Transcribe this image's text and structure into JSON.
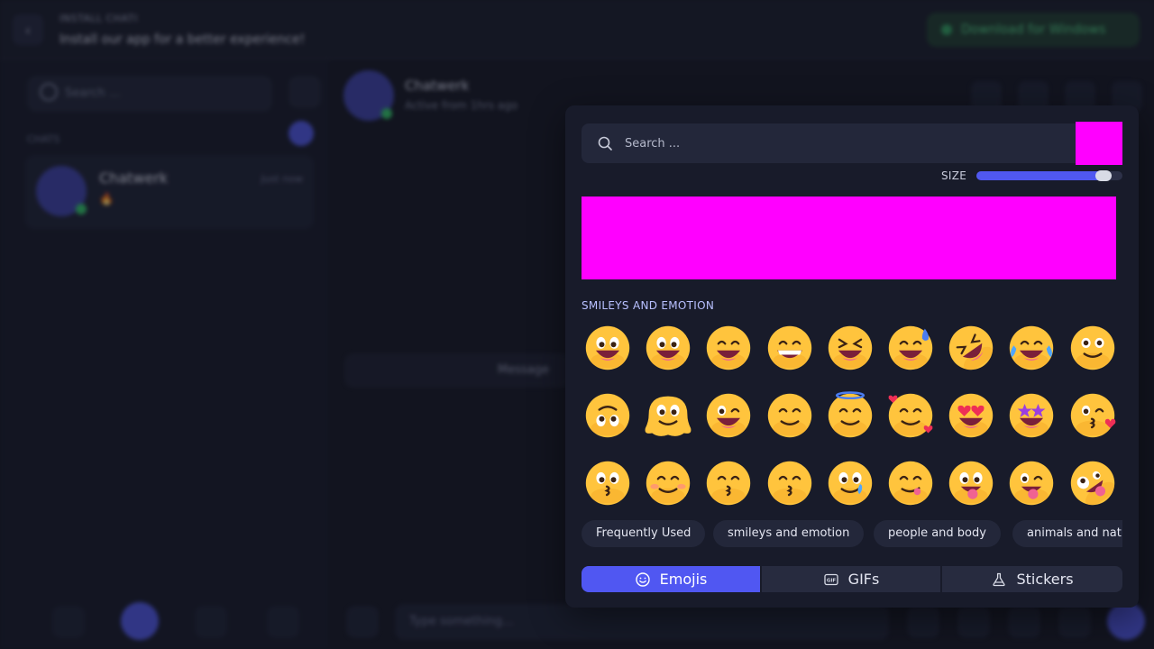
{
  "background": {
    "install_title": "INSTALL CHATI",
    "install_subtitle": "Install our app for a better experience!",
    "download_button": "Download for Windows",
    "search_placeholder": "Search ...",
    "chats_label": "CHATS",
    "chat_name": "Chatwerk",
    "chat_time": "Just now",
    "chat_snippet": "🔥",
    "header_name": "Chatwerk",
    "header_status": "Active from 1hrs ago",
    "message_hint": "Message",
    "type_placeholder": "Type something..."
  },
  "picker": {
    "search_placeholder": "Search ...",
    "size_label": "SIZE",
    "size_value": 0.92,
    "section_title": "SMILEYS AND EMOTION",
    "emojis": [
      {
        "name": "grinning-face",
        "eyes": "open",
        "mouth": "grin"
      },
      {
        "name": "grinning-face-big-eyes",
        "eyes": "open",
        "mouth": "grin"
      },
      {
        "name": "grinning-face-smiling-eyes",
        "eyes": "arc",
        "mouth": "grin"
      },
      {
        "name": "beaming-face",
        "eyes": "arc",
        "mouth": "teeth"
      },
      {
        "name": "grinning-squinting-face",
        "eyes": "squint",
        "mouth": "grin"
      },
      {
        "name": "grinning-face-with-sweat",
        "eyes": "arc",
        "mouth": "grin",
        "extra": "sweat"
      },
      {
        "name": "rolling-on-floor-laughing",
        "eyes": "squint",
        "mouth": "grin",
        "extra": "tilt"
      },
      {
        "name": "face-with-tears-of-joy",
        "eyes": "arc",
        "mouth": "grin",
        "extra": "tears"
      },
      {
        "name": "slightly-smiling-face",
        "eyes": "round",
        "mouth": "smile"
      },
      {
        "name": "upside-down-face",
        "eyes": "open",
        "mouth": "smile",
        "extra": "flip"
      },
      {
        "name": "melting-face",
        "eyes": "open",
        "mouth": "smile",
        "extra": "melt"
      },
      {
        "name": "winking-face",
        "eyes": "wink",
        "mouth": "grin"
      },
      {
        "name": "smiling-face-smiling-eyes",
        "eyes": "arc",
        "mouth": "smile"
      },
      {
        "name": "smiling-face-with-halo",
        "eyes": "arc",
        "mouth": "smile",
        "extra": "halo"
      },
      {
        "name": "smiling-face-with-hearts",
        "eyes": "arc",
        "mouth": "smile",
        "extra": "hearts"
      },
      {
        "name": "smiling-face-with-heart-eyes",
        "eyes": "heart",
        "mouth": "grin"
      },
      {
        "name": "star-struck",
        "eyes": "star",
        "mouth": "grin"
      },
      {
        "name": "face-blowing-a-kiss",
        "eyes": "wink",
        "mouth": "kiss",
        "extra": "kiss-heart"
      },
      {
        "name": "kissing-face",
        "eyes": "open",
        "mouth": "kiss"
      },
      {
        "name": "smiling-face",
        "eyes": "arc",
        "mouth": "smile",
        "extra": "blush"
      },
      {
        "name": "kissing-face-closed-eyes",
        "eyes": "arc",
        "mouth": "kiss"
      },
      {
        "name": "kissing-face-smiling-eyes",
        "eyes": "arc",
        "mouth": "kiss"
      },
      {
        "name": "smiling-face-with-tear",
        "eyes": "open",
        "mouth": "smile",
        "extra": "tear"
      },
      {
        "name": "face-savoring-food",
        "eyes": "arc",
        "mouth": "tongue-side"
      },
      {
        "name": "face-with-tongue",
        "eyes": "open",
        "mouth": "tongue"
      },
      {
        "name": "winking-face-with-tongue",
        "eyes": "wink",
        "mouth": "tongue"
      },
      {
        "name": "zany-face",
        "eyes": "zany",
        "mouth": "tongue",
        "extra": "tilt"
      }
    ],
    "categories": [
      {
        "label": "Frequently Used"
      },
      {
        "label": "smileys and emotion"
      },
      {
        "label": "people and body"
      },
      {
        "label": "animals and nat"
      }
    ],
    "tabs": [
      {
        "label": "Emojis",
        "icon": "smiley-icon",
        "active": true
      },
      {
        "label": "GIFs",
        "icon": "gif-icon",
        "active": false
      },
      {
        "label": "Stickers",
        "icon": "flask-icon",
        "active": false
      }
    ]
  },
  "colors": {
    "accent": "#5057f2",
    "placeholder_magenta": "#ff00ff",
    "emoji_face": "#ffc43d"
  }
}
